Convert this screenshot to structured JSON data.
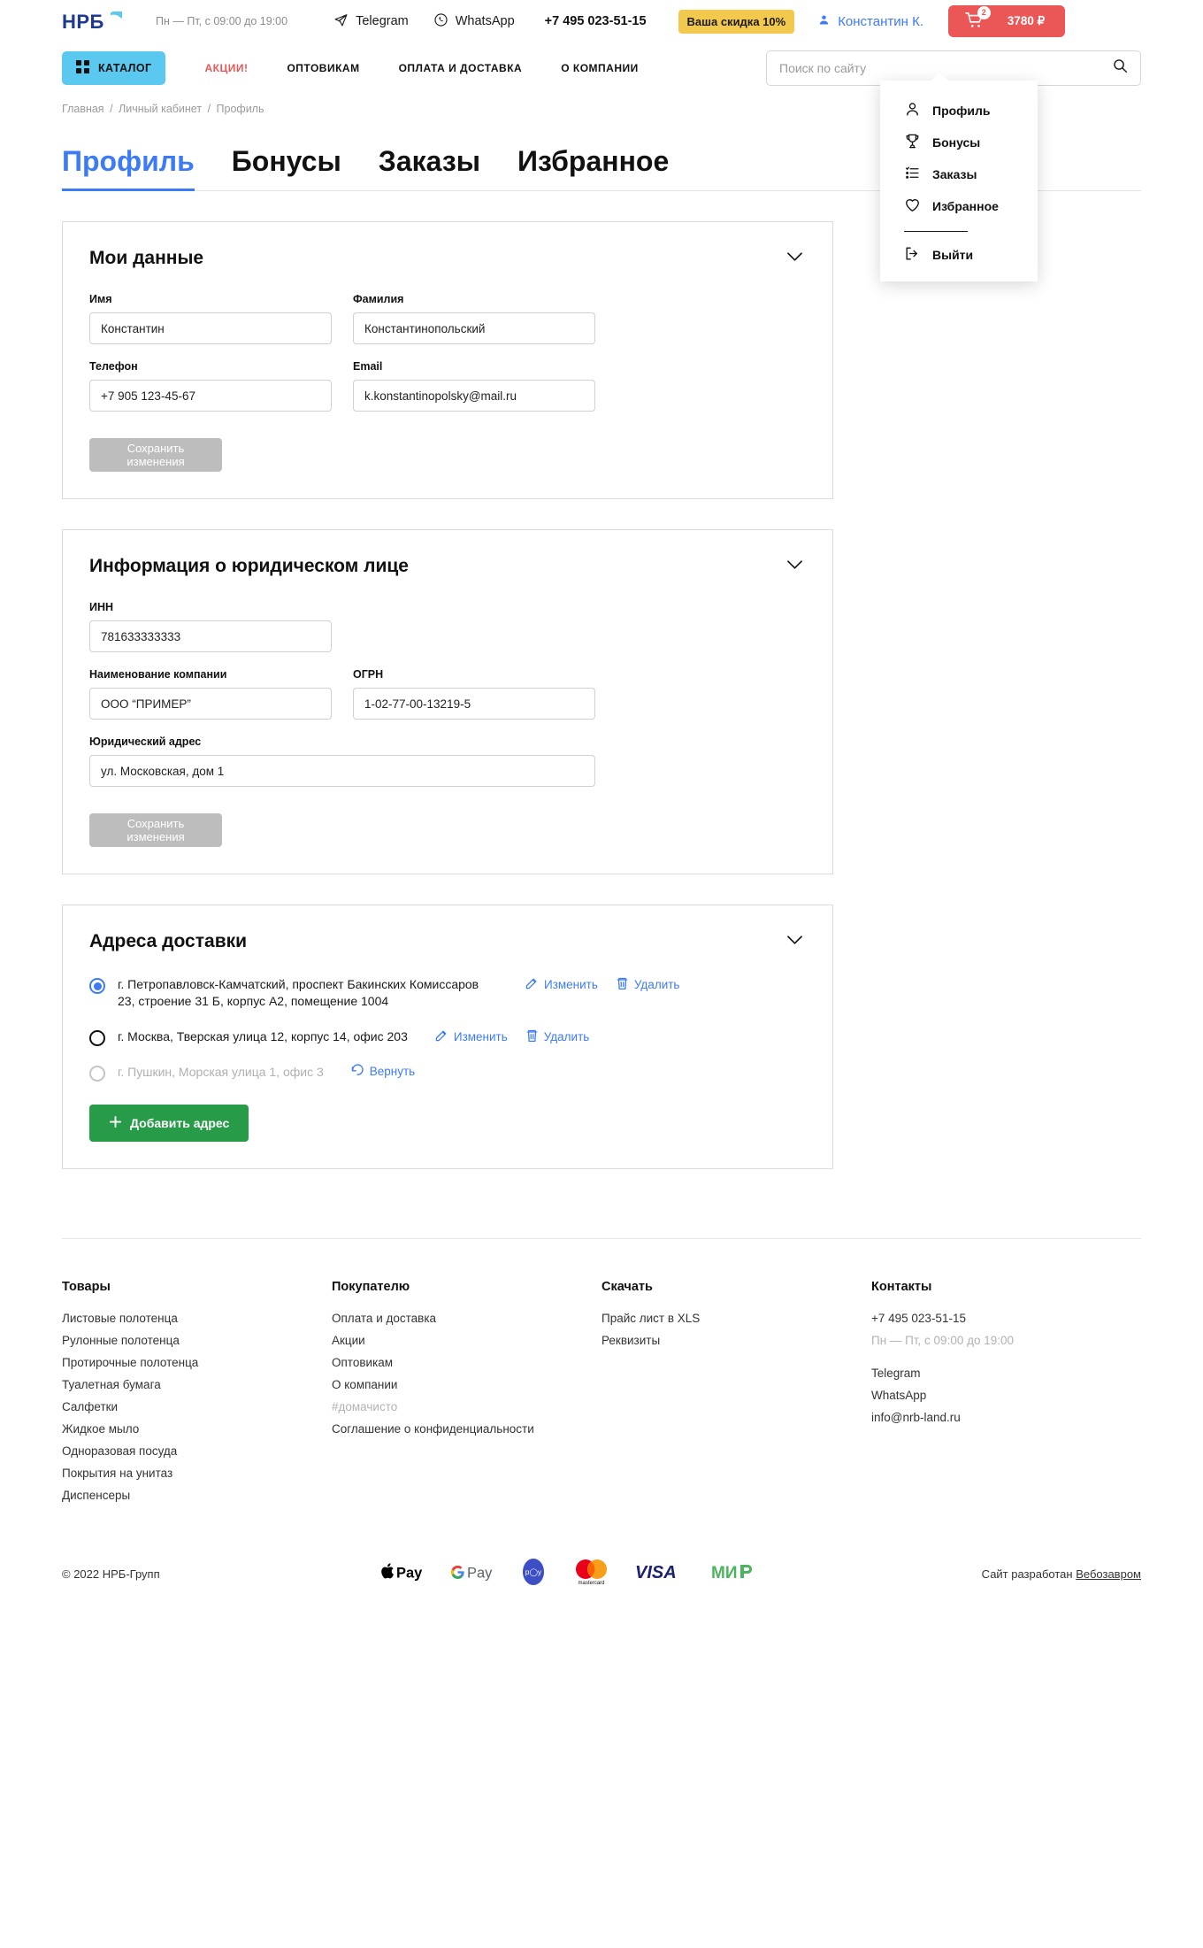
{
  "header": {
    "logo_text": "НРБ",
    "worktime": "Пн — Пт, с 09:00 до 19:00",
    "telegram": "Telegram",
    "whatsapp": "WhatsApp",
    "phone": "+7 495 023-51-15",
    "discount_badge": "Ваша скидка 10%",
    "user_name": "Константин К.",
    "cart_count": "2",
    "cart_total": "3780 ₽"
  },
  "nav": {
    "catalog": "КАТАЛОГ",
    "links": [
      {
        "label": "АКЦИИ!",
        "accent": true
      },
      {
        "label": "ОПТОВИКАМ",
        "accent": false
      },
      {
        "label": "ОПЛАТА И ДОСТАВКА",
        "accent": false
      },
      {
        "label": "О КОМПАНИИ",
        "accent": false
      }
    ],
    "search_placeholder": "Поиск по сайту"
  },
  "user_menu": {
    "items": [
      {
        "label": "Профиль",
        "icon": "user-icon"
      },
      {
        "label": "Бонусы",
        "icon": "trophy-icon"
      },
      {
        "label": "Заказы",
        "icon": "list-icon"
      },
      {
        "label": "Избранное",
        "icon": "heart-icon"
      }
    ],
    "logout": {
      "label": "Выйти",
      "icon": "logout-icon"
    }
  },
  "breadcrumb": {
    "items": [
      "Главная",
      "Личный кабинет",
      "Профиль"
    ],
    "separator": "/"
  },
  "tabs": [
    {
      "label": "Профиль",
      "active": true
    },
    {
      "label": "Бонусы",
      "active": false
    },
    {
      "label": "Заказы",
      "active": false
    },
    {
      "label": "Избранное",
      "active": false
    }
  ],
  "my_data": {
    "title": "Мои данные",
    "fields": [
      {
        "label": "Имя",
        "value": "Константин"
      },
      {
        "label": "Фамилия",
        "value": "Константинопольский"
      },
      {
        "label": "Телефон",
        "value": "+7 905 123-45-67"
      },
      {
        "label": "Email",
        "value": "k.konstantinopolsky@mail.ru"
      }
    ],
    "save_label": "Сохранить изменения"
  },
  "legal": {
    "title": "Информация о юридическом лице",
    "inn_label": "ИНН",
    "inn_value": "781633333333",
    "company_label": "Наименование компании",
    "company_value": "ООО “ПРИМЕР”",
    "ogrn_label": "ОГРН",
    "ogrn_value": "1-02-77-00-13219-5",
    "address_label": "Юридический адрес",
    "address_value": "ул. Московская, дом 1",
    "save_label": "Сохранить изменения"
  },
  "addresses": {
    "title": "Адреса доставки",
    "items": [
      {
        "text": "г. Петропавловск-Камчатский, проспект Бакинских Комиссаров 23, строение 31 Б, корпус А2, помещение 1004",
        "selected": true,
        "deleted": false,
        "edit_label": "Изменить",
        "delete_label": "Удалить"
      },
      {
        "text": "г. Москва, Тверская улица 12, корпус 14, офис 203",
        "selected": false,
        "deleted": false,
        "edit_label": "Изменить",
        "delete_label": "Удалить"
      },
      {
        "text": "г. Пушкин, Морская улица 1, офис 3",
        "selected": false,
        "deleted": true,
        "restore_label": "Вернуть"
      }
    ],
    "add_label": "Добавить адрес"
  },
  "footer": {
    "columns": [
      {
        "title": "Товары",
        "links": [
          {
            "label": "Листовые полотенца",
            "muted": false
          },
          {
            "label": "Рулонные полотенца",
            "muted": false
          },
          {
            "label": "Протирочные полотенца",
            "muted": false
          },
          {
            "label": "Туалетная бумага",
            "muted": false
          },
          {
            "label": "Салфетки",
            "muted": false
          },
          {
            "label": "Жидкое мыло",
            "muted": false
          },
          {
            "label": "Одноразовая посуда",
            "muted": false
          },
          {
            "label": "Покрытия на унитаз",
            "muted": false
          },
          {
            "label": "Диспенсеры",
            "muted": false
          }
        ]
      },
      {
        "title": "Покупателю",
        "links": [
          {
            "label": "Оплата и доставка",
            "muted": false
          },
          {
            "label": "Акции",
            "muted": false
          },
          {
            "label": "Оптовикам",
            "muted": false
          },
          {
            "label": "О компании",
            "muted": false
          },
          {
            "label": "#домачисто",
            "muted": true
          },
          {
            "label": "Соглашение о конфиденциальности",
            "muted": false
          }
        ]
      },
      {
        "title": "Скачать",
        "links": [
          {
            "label": "Прайс лист в XLS",
            "muted": false
          },
          {
            "label": "Реквизиты",
            "muted": false
          }
        ]
      },
      {
        "title": "Контакты",
        "links": [
          {
            "label": "+7 495 023-51-15",
            "muted": false
          },
          {
            "label": "Пн — Пт, с 09:00 до 19:00",
            "muted": true
          },
          {
            "label": "Telegram",
            "muted": false,
            "gap": true
          },
          {
            "label": "WhatsApp",
            "muted": false
          },
          {
            "label": "info@nrb-land.ru",
            "muted": false
          }
        ]
      }
    ],
    "copyright": "© 2022 НРБ-Групп",
    "developer_prefix": "Сайт разработан ",
    "developer_name": "Вебозавром",
    "payments": [
      "apple-pay",
      "google-pay",
      "pay-circle",
      "mastercard",
      "visa",
      "mir"
    ]
  },
  "colors": {
    "accent_blue": "#3D7BF5",
    "catalog_blue": "#5BC8F0",
    "promo_red": "#EB5757",
    "discount_yellow": "#F2C94C",
    "green": "#279B48",
    "disabled_gray": "#BDBDBD"
  }
}
